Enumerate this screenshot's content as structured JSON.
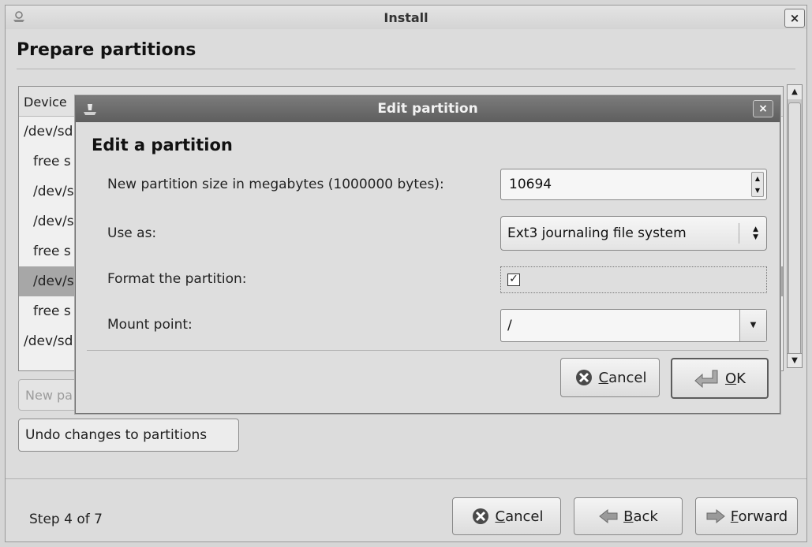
{
  "window": {
    "title": "Install",
    "close_label": "×"
  },
  "page": {
    "title": "Prepare partitions"
  },
  "partition_list": {
    "header": "Device",
    "rows": [
      {
        "text": "/dev/sd",
        "indent": false,
        "selected": false
      },
      {
        "text": "free s",
        "indent": true,
        "selected": false
      },
      {
        "text": "/dev/s",
        "indent": true,
        "selected": false
      },
      {
        "text": "/dev/s",
        "indent": true,
        "selected": false
      },
      {
        "text": "free s",
        "indent": true,
        "selected": false
      },
      {
        "text": "/dev/s",
        "indent": true,
        "selected": true
      },
      {
        "text": "free s",
        "indent": true,
        "selected": false
      },
      {
        "text": "/dev/sd",
        "indent": false,
        "selected": false
      }
    ],
    "new_partition_button": "New pa",
    "undo_button": "Undo changes to partitions"
  },
  "footer": {
    "step": "Step 4 of 7",
    "cancel": {
      "pre": "",
      "accel": "C",
      "post": "ancel"
    },
    "back": {
      "pre": "",
      "accel": "B",
      "post": "ack"
    },
    "forward": {
      "pre": "",
      "accel": "F",
      "post": "orward"
    }
  },
  "dialog": {
    "title": "Edit partition",
    "close_label": "×",
    "heading": "Edit a partition",
    "size_label": "New partition size in megabytes (1000000 bytes):",
    "size_value": "10694",
    "use_as_label": "Use as:",
    "use_as_value": "Ext3 journaling file system",
    "format_label": "Format the partition:",
    "format_checked": true,
    "mount_label": "Mount point:",
    "mount_value": "/",
    "cancel": {
      "accel": "C",
      "post": "ancel"
    },
    "ok": {
      "accel": "O",
      "post": "K"
    }
  }
}
